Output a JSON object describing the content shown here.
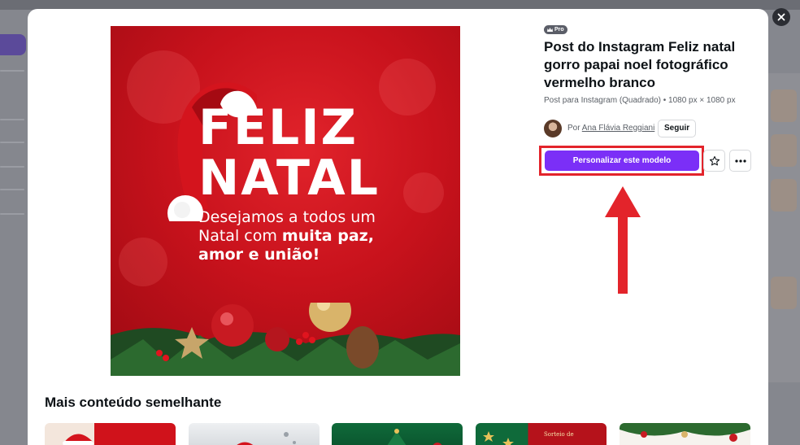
{
  "template": {
    "badge": "Pro",
    "badge_icon": "crown-icon",
    "title": "Post do Instagram Feliz natal gorro papai noel fotográfico vermelho branco",
    "subtitle": "Post para Instagram (Quadrado) • 1080 px × 1080 px",
    "author_prefix": "Por",
    "author_name": "Ana Flávia Reggiani",
    "follow_label": "Seguir",
    "cta_label": "Personalizar este modelo",
    "favorite_icon": "star-icon",
    "more_icon": "more-horizontal-icon",
    "close_icon": "close-icon"
  },
  "preview": {
    "headline_1": "FELIZ",
    "headline_2": "NATAL",
    "message_plain_1": "Desejamos a todos um Natal com ",
    "message_bold_1": "muita paz,",
    "message_bold_2": "amor e união!"
  },
  "similar": {
    "heading": "Mais conteúdo semelhante",
    "thumbs": [
      {
        "kind": "santa-red"
      },
      {
        "kind": "santa-white"
      },
      {
        "kind": "green-tree"
      },
      {
        "kind": "sorteio",
        "text": "Sorteio de"
      },
      {
        "kind": "white-wreath"
      }
    ]
  },
  "colors": {
    "accent": "#7b2ff7",
    "annotation": "#e3242b",
    "preview_red": "#c8121c"
  }
}
